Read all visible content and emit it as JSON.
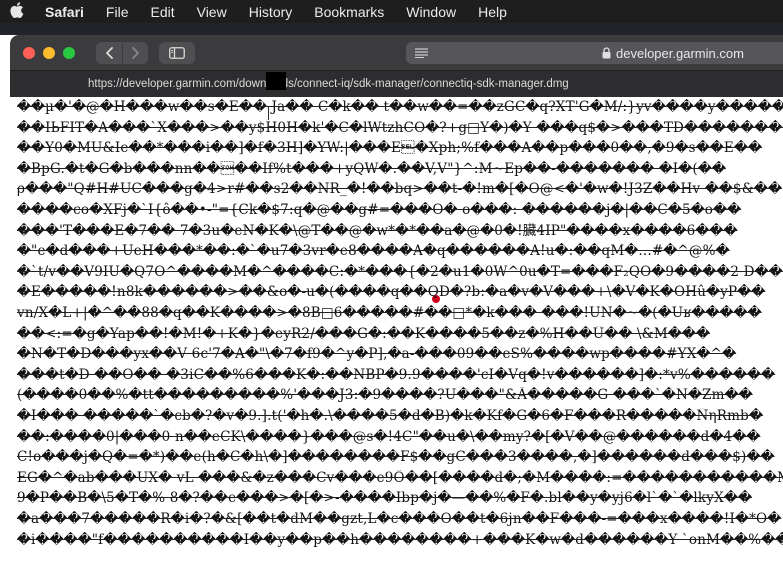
{
  "menubar": {
    "apple_icon": "apple-logo-icon",
    "items": [
      {
        "label": "Safari",
        "app": true
      },
      {
        "label": "File"
      },
      {
        "label": "Edit"
      },
      {
        "label": "View"
      },
      {
        "label": "History"
      },
      {
        "label": "Bookmarks"
      },
      {
        "label": "Window"
      },
      {
        "label": "Help"
      }
    ]
  },
  "window": {
    "traffic_lights": [
      "close",
      "minimize",
      "zoom"
    ],
    "colors": {
      "close": "#ff5f57",
      "minimize": "#febc2e",
      "zoom": "#28c840"
    },
    "back_icon": "chevron-left-icon",
    "forward_icon": "chevron-right-icon",
    "sidebar_icon": "sidebar-icon",
    "reader_icon": "reader-lines-icon",
    "lock_icon": "lock-icon",
    "address_domain": "developer.garmin.com",
    "tab_url": "https://developer.garmin.com/downloads/connect-iq/sdk-manager/connectiq-sdk-manager.dmg"
  },
  "page": {
    "lines": [
      "��µ�'�@�H���w��s�E�� Ja�� C�k�� t��w��=��zGC�q?XT'G�M/:}yv����y�������",
      "��IЬFIT�A���`X���>��y$H0H�k'�C�lWtzhCO�?+g□Y�)�Y ���q$�>���TD���������",
      "��Y0�MU&Ie��*���i��]�f�3H]�YW:|���E\u0007�Xph;%f���A��p���0��,�9�s��E��",
      "�BpG.�t�G�b���nn��\u0001��If%t���+yQW�.��V,V\"}^:M~Ep��-�������   �I�(��",
      "ρ���\"Q#H#UC���g�4>r#��s2��NR_�!��bq>��t-�!m�[�O@<�'�w�!J3Z��Hv ��$&��",
      "����co�XFj�`I{ô��•-\"={Ck�$7:q�@��g#=���O� o���: ������j�|��C�5�o��",
      "���'T���E�7�� 7�3u�eN�K�\\@T��@�w*�*��a�@�0�!臟4IP\"����x����6���",
      "�\"e�d���+UeH���*��:�`�u7�3vr�e8����A�q������A!u�:��qM�...#�^@%�",
      "�`t/v��V9IU�Q7O^����M�^����C:�*���{�2�u1�0W^0u�T=���F₂QO�9����2 D���",
      "�E�����!n8k������>��&o�-u�(����q��QD�?b:�a�v�V���+\\�V�K�OHû�yP��",
      "vn/X�L+|�^��88�q��K����>�8B□6�����#��□*�k��� ���!UN�~�(�Uʁ�����",
      "��<:=�g�Yap��!�M!�+K�}�eyR2/���G�:��K����5��z�%H��Û�� \\&M���",
      "�N�T�D���yx��V 6c'7�A�\"\\�7�f9�^y�P],�a-���09��eS%����wp����#YX�^�",
      "���t�D ��O�� �3iC��%6���K�:��NBP�9.9����'cI�Vq�!v������]�:*v%������",
      "(����0��%�tt���������%'���J3:�9����?U���\"&Ã�����G ���`�N�Zm��",
      "�I��� �����`�cb�?�v�9.].t('�h�.\\����5�d�B)�k�Kf�G�6�F���R�����ÑηRmb�",
      "��:����0|���0 n��eCK\\����}���@s�!4C\"��u�\\��my?�[�V��@������d�4��",
      "C!o���j�Q�=�*)��e(h�C�h\\�]��������F$��gC���3����,�]������d���$)��",
      "EG�^�ab���UX� vL ���&�z���Cv���e9Ô��[����d�;�M����:=�����������M�",
      "9�P��B�\\5�T�% 8�?��e���>�[�>-����Ibp�j�—��%�F�.bl��y�yj6�l`�`�lkyX��",
      "�a���7�����R�i�?�&[��t�dM��gzt,L�c���O��t�6jn��F���-=���x����!I�*O�",
      "�i����\"f����������I��y��p��h��������+���K�w�d������Y `onM��%���"
    ]
  }
}
